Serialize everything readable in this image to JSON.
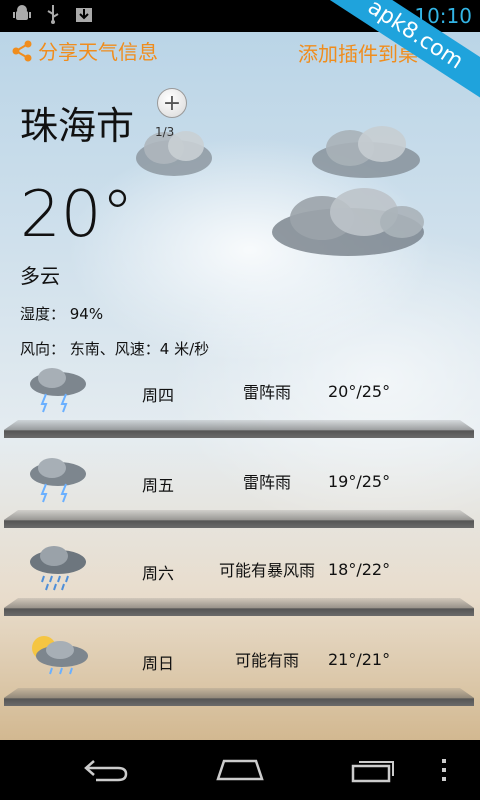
{
  "status_bar": {
    "icons": [
      "android-debug-icon",
      "usb-icon",
      "download-icon"
    ],
    "time": "10:10"
  },
  "watermark": "apk8.com",
  "top": {
    "share_label": "分享天气信息",
    "add_widget_label": "添加插件到桌"
  },
  "current": {
    "city": "珠海市",
    "page_indicator": "1/3",
    "temperature": "20°",
    "condition": "多云",
    "humidity": "湿度： 94%",
    "wind": "风向： 东南、风速：4 米/秒"
  },
  "forecast": [
    {
      "day": "周四",
      "desc": "雷阵雨",
      "temp": "20°/25°",
      "icon": "thunderstorm-icon"
    },
    {
      "day": "周五",
      "desc": "雷阵雨",
      "temp": "19°/25°",
      "icon": "thunderstorm-icon"
    },
    {
      "day": "周六",
      "desc": "可能有暴风雨",
      "temp": "18°/22°",
      "icon": "heavy-rain-icon"
    },
    {
      "day": "周日",
      "desc": "可能有雨",
      "temp": "21°/21°",
      "icon": "sun-cloud-rain-icon"
    }
  ],
  "colors": {
    "accent": "#f08d1d",
    "status_accent": "#33b5e5",
    "watermark_bg": "#1fa3dc"
  }
}
